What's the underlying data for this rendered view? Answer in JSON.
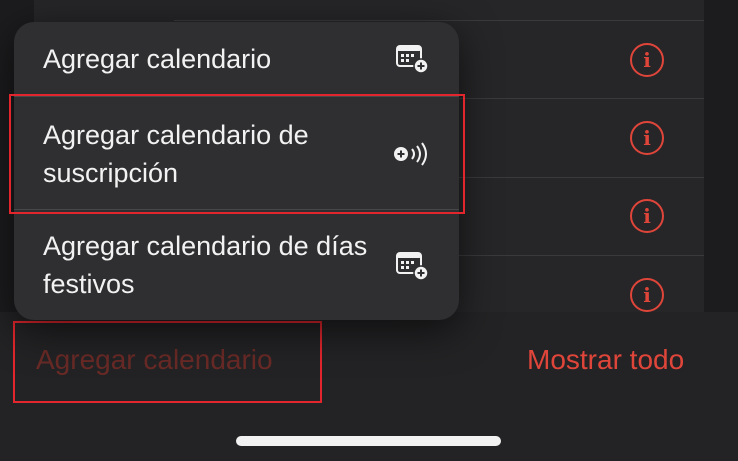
{
  "menu": {
    "items": [
      {
        "label": "Agregar calendario",
        "icon": "calendar-add-icon"
      },
      {
        "label": "Agregar calendario de suscripción",
        "icon": "subscription-add-icon"
      },
      {
        "label": "Agregar calendario de días festivos",
        "icon": "holiday-calendar-add-icon"
      }
    ]
  },
  "toolbar": {
    "add_calendar_label": "Agregar calendario",
    "show_all_label": "Mostrar todo"
  },
  "info_icons": [
    "info-icon",
    "info-icon",
    "info-icon",
    "info-icon"
  ],
  "colors": {
    "accent": "#e0453a",
    "highlight_border": "#e3262d",
    "menu_bg": "#2f2f31",
    "page_bg": "#1c1c1e"
  }
}
